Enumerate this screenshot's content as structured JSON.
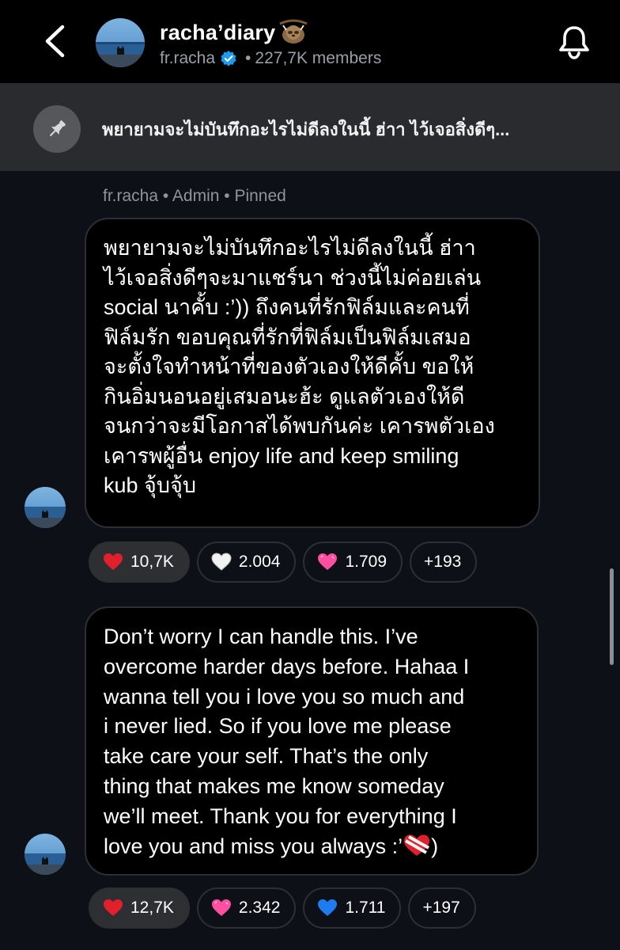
{
  "header": {
    "title": "racha’diary",
    "username": "fr.racha",
    "members": "227,7K members",
    "separator": "•"
  },
  "pinned_bar": {
    "text": "พยายามจะไม่บันทึกอะไรไม่ดีลงในนี้ ฮ่าา ไว้เจอสิ่งดีๆ..."
  },
  "message1": {
    "meta": "fr.racha • Admin • Pinned",
    "lines": [
      "พยายามจะไม่บันทึกอะไรไม่ดีลงในนี้ ฮ่าา",
      "ไว้เจอสิ่งดีๆจะมาแชร์นา ช่วงนี้ไม่ค่อยเล่น",
      "social นาคั้บ :’)) ถึงคนที่รักฟิล์มและคนที่",
      "ฟิล์มรัก ขอบคุณที่รักที่ฟิล์มเป็นฟิล์มเสมอ",
      "จะตั้งใจทำหน้าที่ของตัวเองให้ดีคั้บ ขอให้",
      "กินอิ่มนอนอยู่เสมอนะฮ้ะ ดูแลตัวเองให้ดี",
      "จนกว่าจะมีโอกาสได้พบกันค่ะ เคารพตัวเอง",
      "เคารพผู้อื่น enjoy life and keep smiling",
      "kub จุ้บจุ้บ"
    ],
    "reactions": [
      {
        "icon": "red-heart-icon",
        "color": "#e0202b",
        "count": "10,7K",
        "active": true
      },
      {
        "icon": "white-heart-icon",
        "color": "#f2f2f2",
        "count": "2.004",
        "active": false
      },
      {
        "icon": "pink-heart-icon",
        "color": "#ff4fa0",
        "count": "1.709",
        "active": false
      }
    ],
    "more": "+193"
  },
  "message2": {
    "lines": [
      "Don’t worry I can handle this. I’ve",
      "overcome harder days before. Hahaa I",
      "wanna tell you i love you so much and",
      "i never lied. So if you love me please",
      "take care your self. That’s the only",
      "thing that makes me know someday",
      "we’ll meet. Thank you for everything I"
    ],
    "last_line_before": "love you and miss you always :’",
    "last_line_after": ")",
    "reactions": [
      {
        "icon": "red-heart-icon",
        "color": "#e0202b",
        "count": "12,7K",
        "active": true
      },
      {
        "icon": "pink-heart-icon",
        "color": "#ff4fa0",
        "count": "2.342",
        "active": false
      },
      {
        "icon": "blue-heart-icon",
        "color": "#1f7cf0",
        "count": "1.711",
        "active": false
      }
    ],
    "more": "+197"
  },
  "colors": {
    "background": "#0d1117",
    "header": "#000000",
    "pinned_bar": "#2a2b2e",
    "verified": "#1d9bf0"
  }
}
